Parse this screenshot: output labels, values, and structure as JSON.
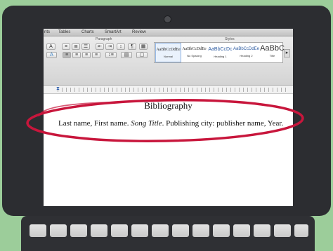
{
  "ribbon": {
    "tabs": [
      "nts",
      "Tables",
      "Charts",
      "SmartArt",
      "Review"
    ],
    "group_paragraph": "Paragraph",
    "group_styles": "Styles",
    "styles": [
      {
        "sample": "AaBbCcDdEe",
        "name": "Normal",
        "selected": true
      },
      {
        "sample": "AaBbCcDdEe",
        "name": "No Spacing",
        "selected": false
      },
      {
        "sample": "AaBbCcDc",
        "name": "Heading 1",
        "selected": false
      },
      {
        "sample": "AaBbCcDdEe",
        "name": "Heading 2",
        "selected": false
      },
      {
        "sample": "AaBbC",
        "name": "Title",
        "selected": false
      }
    ]
  },
  "document": {
    "title": "Bibliography",
    "citation_part1": "Last name, First name. ",
    "citation_italic": "Song Title",
    "citation_part2": ". Publishing city: publisher name, Year."
  },
  "colors": {
    "background": "#9ccd9a",
    "annotation": "#c8163c",
    "bezel": "#2c2d31"
  }
}
